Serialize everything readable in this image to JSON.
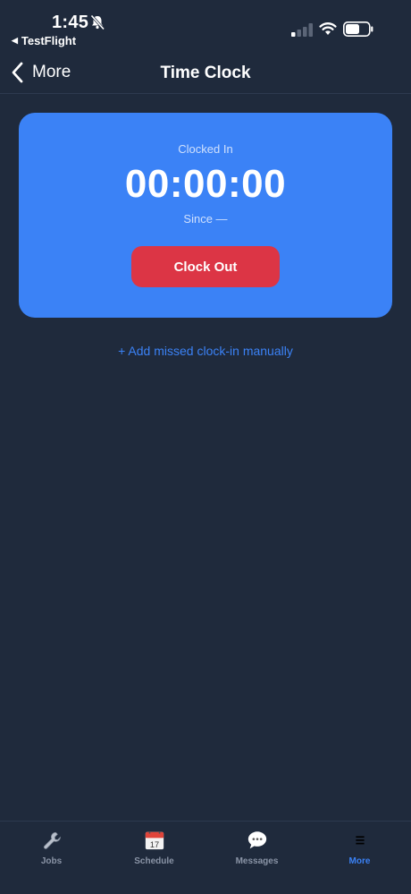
{
  "status_bar": {
    "time": "1:45",
    "back_app": "TestFlight"
  },
  "nav": {
    "back_label": "More",
    "title": "Time Clock"
  },
  "clock_card": {
    "status": "Clocked In",
    "timer": "00:00:00",
    "since": "Since —",
    "button_label": "Clock Out"
  },
  "add_missed_link": "+ Add missed clock-in manually",
  "tabs": [
    {
      "label": "Jobs",
      "icon": "wrench-icon",
      "active": false
    },
    {
      "label": "Schedule",
      "icon": "calendar-icon",
      "active": false
    },
    {
      "label": "Messages",
      "icon": "speech-bubble-icon",
      "active": false
    },
    {
      "label": "More",
      "icon": "menu-icon",
      "active": true
    }
  ],
  "calendar_icon_day": "17",
  "colors": {
    "background": "#1f2a3c",
    "card": "#3b82f6",
    "clock_out_button": "#dc3545",
    "link": "#3b82f6",
    "tab_inactive": "#8a94a6",
    "tab_active": "#3b82f6"
  }
}
